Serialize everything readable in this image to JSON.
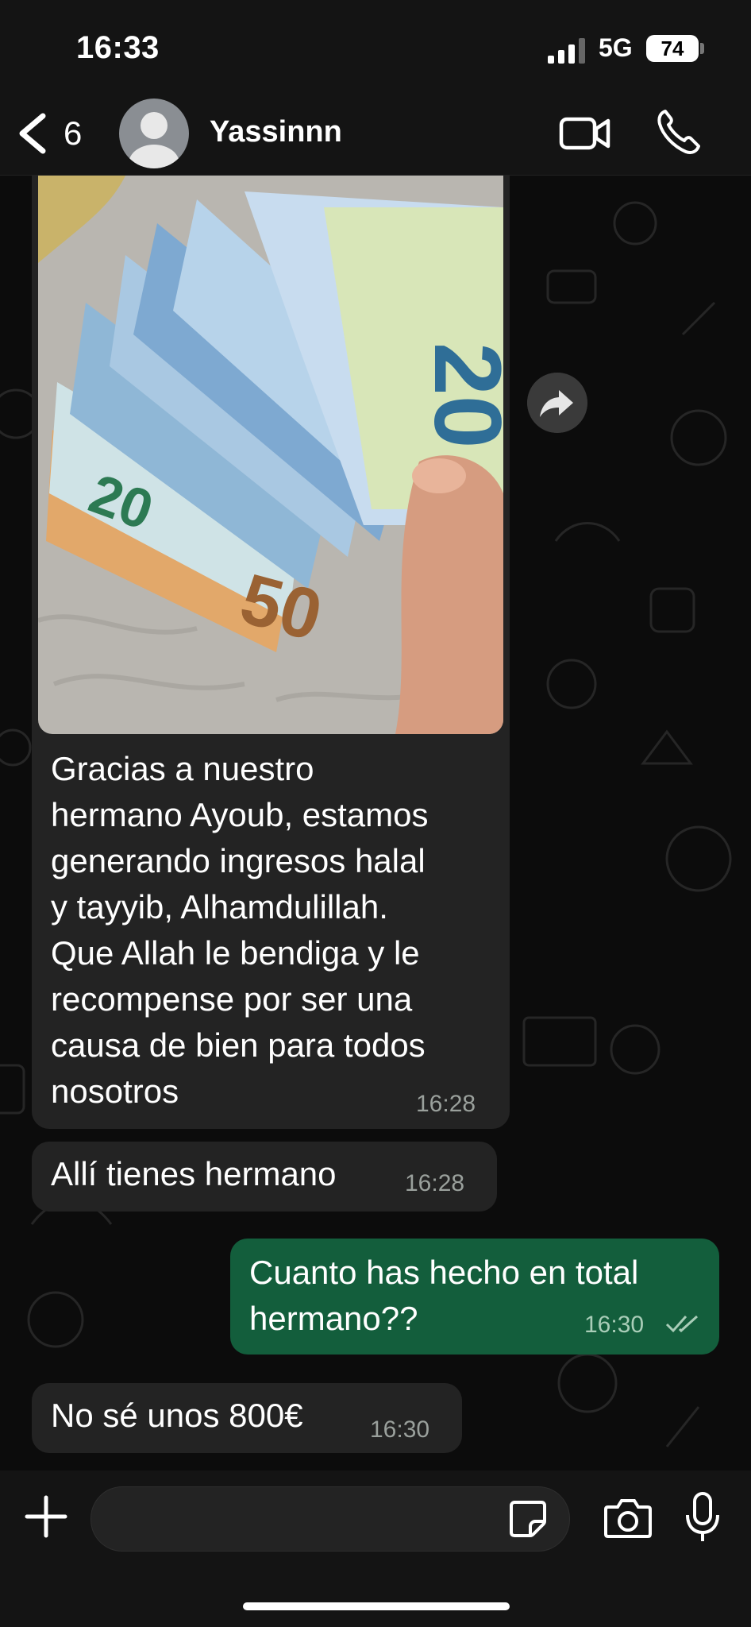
{
  "status": {
    "time": "16:33",
    "network": "5G",
    "battery": "74"
  },
  "header": {
    "unread_count": "6",
    "contact_name": "Yassinnn"
  },
  "messages": [
    {
      "text_lines": [
        "Gracias a nuestro",
        "hermano Ayoub, estamos",
        "generando ingresos halal",
        "y tayyib, Alhamdulillah.",
        "Que Allah le bendiga y le",
        "recompense por ser una",
        "causa de bien para todos",
        "nosotros"
      ],
      "time": "16:28"
    },
    {
      "text": "Allí tienes hermano",
      "time": "16:28"
    },
    {
      "text_lines": [
        "Cuanto has hecho en total",
        "hermano??"
      ],
      "time": "16:30"
    },
    {
      "text": "No sé unos 800€",
      "time": "16:30"
    }
  ],
  "colors": {
    "incoming": "#232323",
    "outgoing": "#135e3c",
    "background": "#0c0c0c"
  }
}
